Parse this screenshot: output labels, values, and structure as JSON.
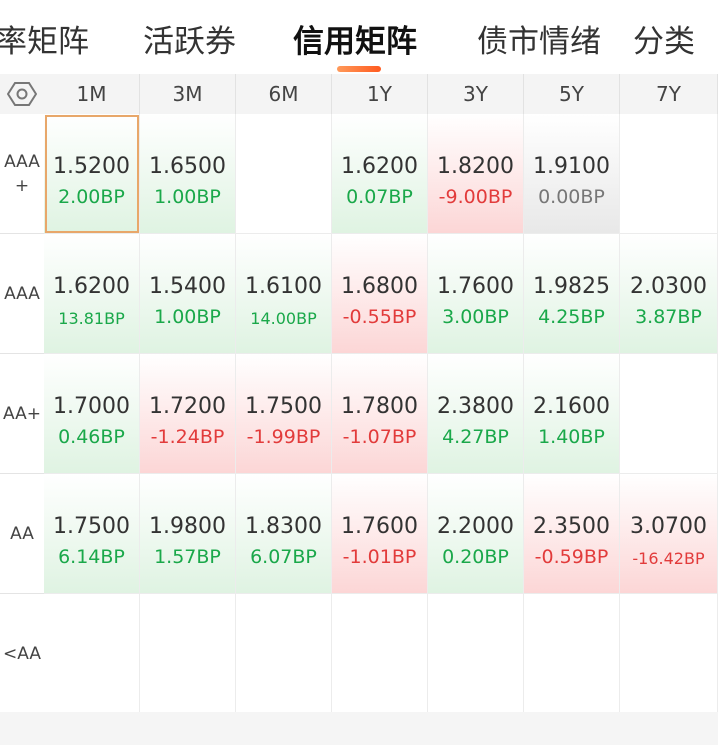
{
  "tabs": [
    {
      "label": "率矩阵",
      "active": false
    },
    {
      "label": "活跃券",
      "active": false
    },
    {
      "label": "信用矩阵",
      "active": true
    },
    {
      "label": "债市情绪",
      "active": false
    },
    {
      "label": "分类",
      "active": false
    }
  ],
  "settings_icon": "hexagon-gear-icon",
  "columns": [
    "1M",
    "3M",
    "6M",
    "1Y",
    "3Y",
    "5Y",
    "7Y"
  ],
  "rows": [
    {
      "label": "AAA\n+",
      "cells": [
        {
          "value": "1.5200",
          "change": "2.00BP",
          "dir": "up",
          "selected": true
        },
        {
          "value": "1.6500",
          "change": "1.00BP",
          "dir": "up"
        },
        null,
        {
          "value": "1.6200",
          "change": "0.07BP",
          "dir": "up"
        },
        {
          "value": "1.8200",
          "change": "-9.00BP",
          "dir": "down"
        },
        {
          "value": "1.9100",
          "change": "0.00BP",
          "dir": "flat"
        },
        null
      ]
    },
    {
      "label": "AAA",
      "cells": [
        {
          "value": "1.6200",
          "change": "13.81BP",
          "dir": "up",
          "small": true
        },
        {
          "value": "1.5400",
          "change": "1.00BP",
          "dir": "up"
        },
        {
          "value": "1.6100",
          "change": "14.00BP",
          "dir": "up",
          "small": true
        },
        {
          "value": "1.6800",
          "change": "-0.55BP",
          "dir": "down"
        },
        {
          "value": "1.7600",
          "change": "3.00BP",
          "dir": "up"
        },
        {
          "value": "1.9825",
          "change": "4.25BP",
          "dir": "up"
        },
        {
          "value": "2.0300",
          "change": "3.87BP",
          "dir": "up"
        }
      ]
    },
    {
      "label": "AA+",
      "cells": [
        {
          "value": "1.7000",
          "change": "0.46BP",
          "dir": "up"
        },
        {
          "value": "1.7200",
          "change": "-1.24BP",
          "dir": "down"
        },
        {
          "value": "1.7500",
          "change": "-1.99BP",
          "dir": "down"
        },
        {
          "value": "1.7800",
          "change": "-1.07BP",
          "dir": "down"
        },
        {
          "value": "2.3800",
          "change": "4.27BP",
          "dir": "up"
        },
        {
          "value": "2.1600",
          "change": "1.40BP",
          "dir": "up"
        },
        null
      ]
    },
    {
      "label": "AA",
      "cells": [
        {
          "value": "1.7500",
          "change": "6.14BP",
          "dir": "up"
        },
        {
          "value": "1.9800",
          "change": "1.57BP",
          "dir": "up"
        },
        {
          "value": "1.8300",
          "change": "6.07BP",
          "dir": "up"
        },
        {
          "value": "1.7600",
          "change": "-1.01BP",
          "dir": "down"
        },
        {
          "value": "2.2000",
          "change": "0.20BP",
          "dir": "up"
        },
        {
          "value": "2.3500",
          "change": "-0.59BP",
          "dir": "down"
        },
        {
          "value": "3.0700",
          "change": "-16.42BP",
          "dir": "down",
          "small": true
        }
      ]
    },
    {
      "label": "<AA",
      "cells": [
        null,
        null,
        null,
        null,
        null,
        null,
        null
      ]
    }
  ],
  "colors": {
    "up": "#1aa84a",
    "down": "#e23b3b",
    "flat": "#777777",
    "accent": "#ff5a1f"
  }
}
